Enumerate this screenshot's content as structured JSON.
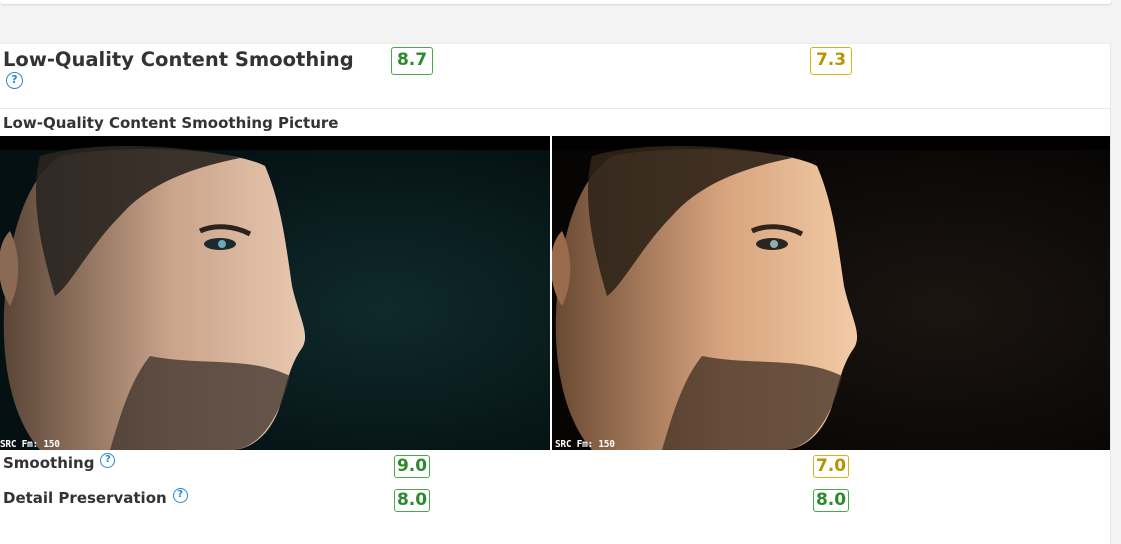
{
  "section": {
    "title": "Low-Quality Content Smoothing",
    "help_glyph": "?",
    "scores": [
      {
        "value": "8.7",
        "color": "#2c8a2c"
      },
      {
        "value": "7.3",
        "color": "#b59500"
      }
    ]
  },
  "picture": {
    "label": "Low-Quality Content Smoothing Picture",
    "images": [
      {
        "caption": "SRC Fm: 150",
        "alt": "Close-up of a bearded man's face in profile, dark teal-tinted background",
        "tone": "cool"
      },
      {
        "caption": "SRC Fm: 150",
        "alt": "Close-up of a bearded man's face in profile, dark warm-tinted background",
        "tone": "warm"
      }
    ]
  },
  "rows": [
    {
      "label": "Smoothing",
      "help_glyph": "?",
      "scores": [
        {
          "value": "9.0",
          "color": "#2c8a2c"
        },
        {
          "value": "7.0",
          "color": "#b59500"
        }
      ]
    },
    {
      "label": "Detail Preservation",
      "help_glyph": "?",
      "scores": [
        {
          "value": "8.0",
          "color": "#2c8a2c"
        },
        {
          "value": "8.0",
          "color": "#2c8a2c"
        }
      ]
    }
  ]
}
